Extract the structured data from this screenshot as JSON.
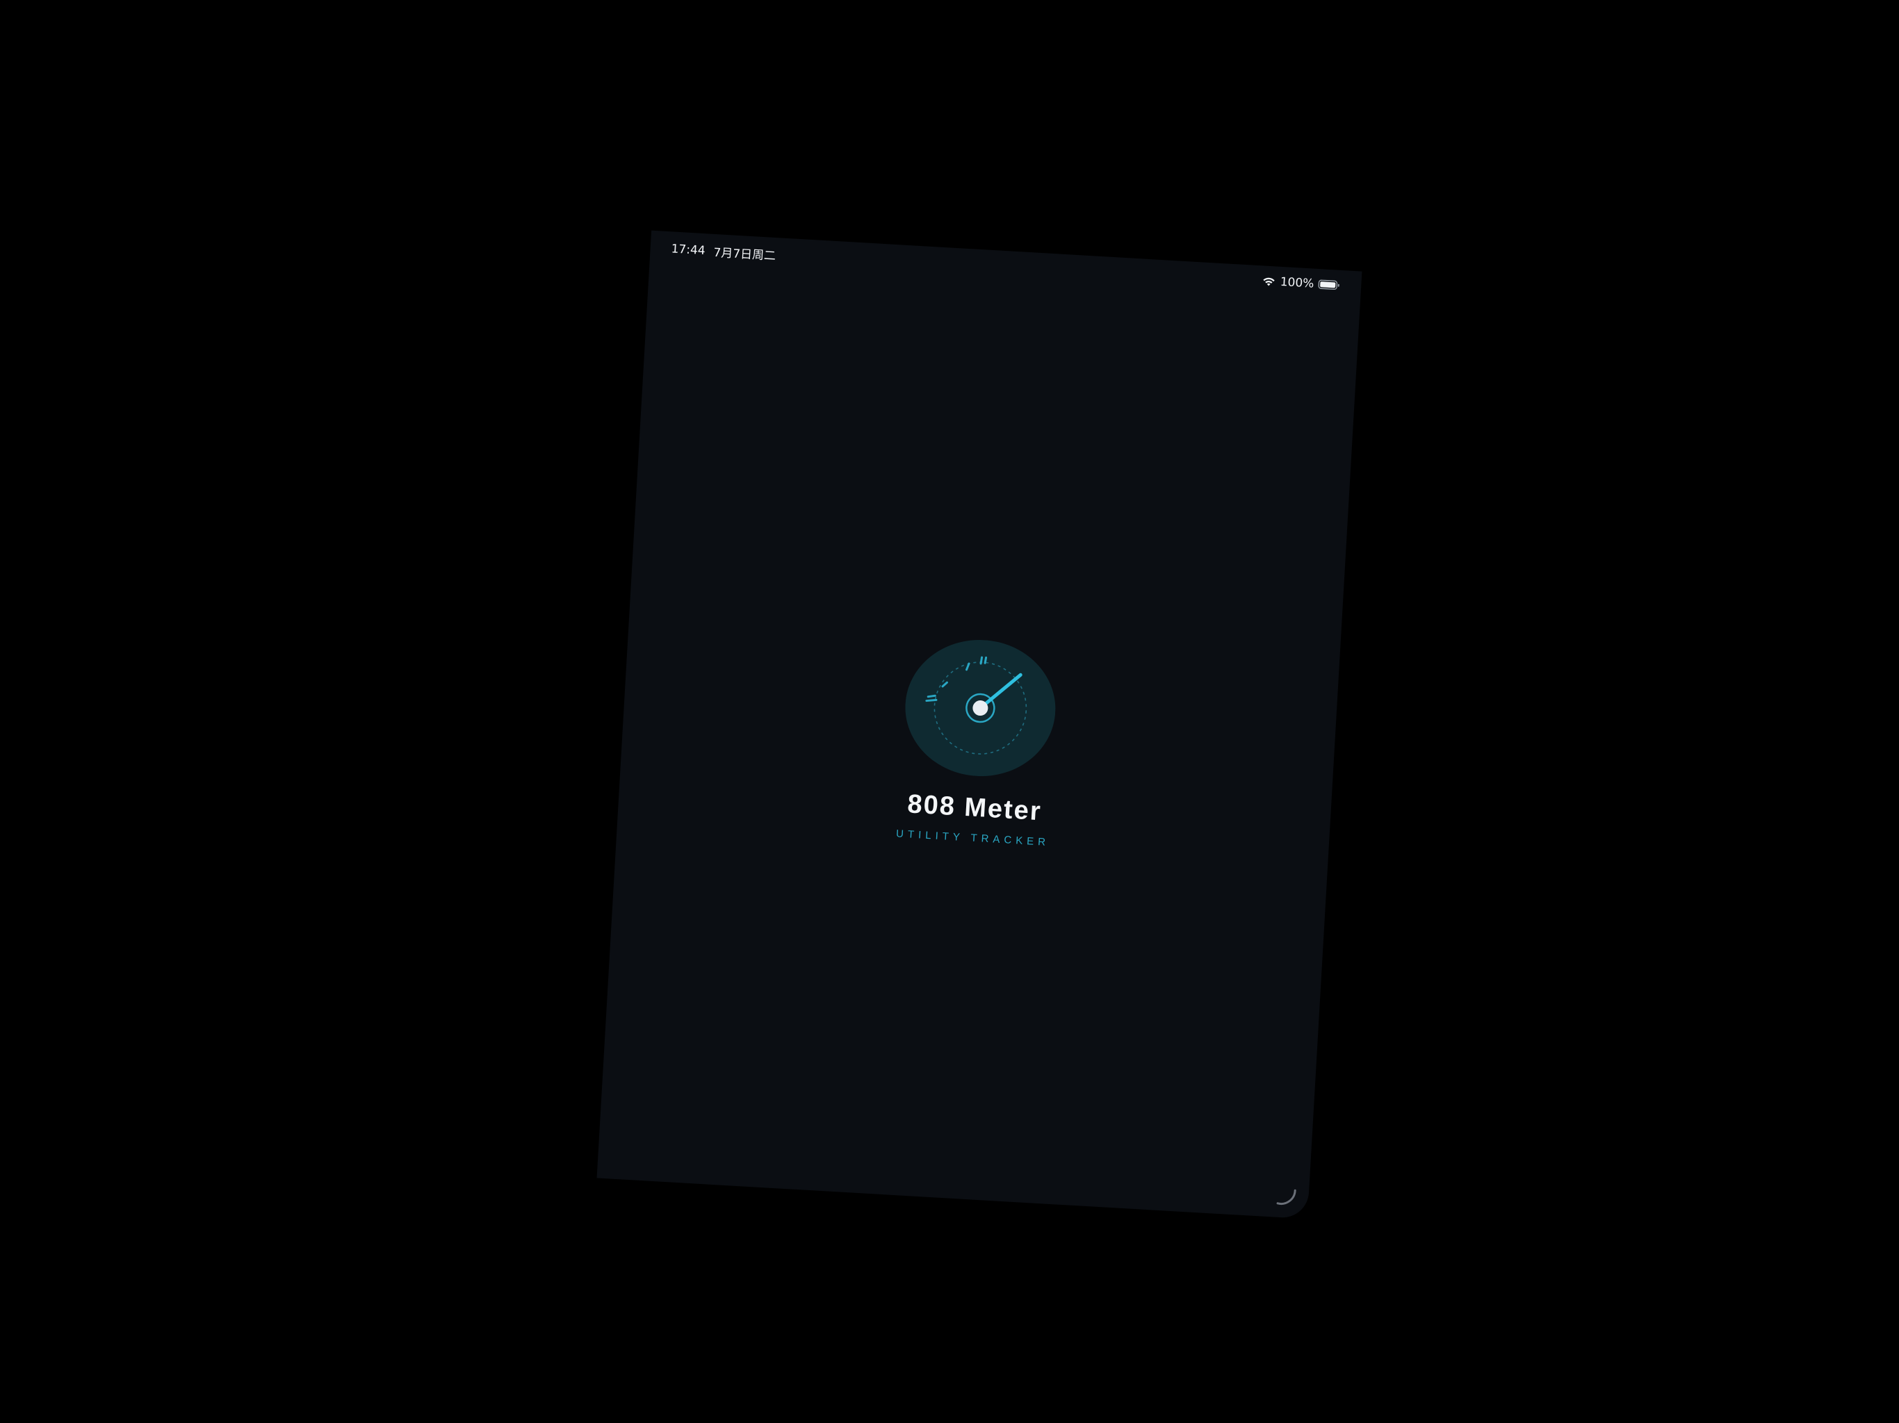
{
  "status_bar": {
    "time": "17:44",
    "date": "7月7日周二",
    "wifi_icon": "wifi-icon",
    "battery_percent": "100%",
    "battery_icon": "battery-icon",
    "battery_level": 1.0
  },
  "splash": {
    "logo_icon": "gauge-icon",
    "title": "808 Meter",
    "subtitle": "UTILITY TRACKER"
  },
  "colors": {
    "background": "#0b0e13",
    "outer": "#000000",
    "accent": "#2aa7c4",
    "badge": "#0f2a31",
    "text": "#f4f6f8"
  }
}
